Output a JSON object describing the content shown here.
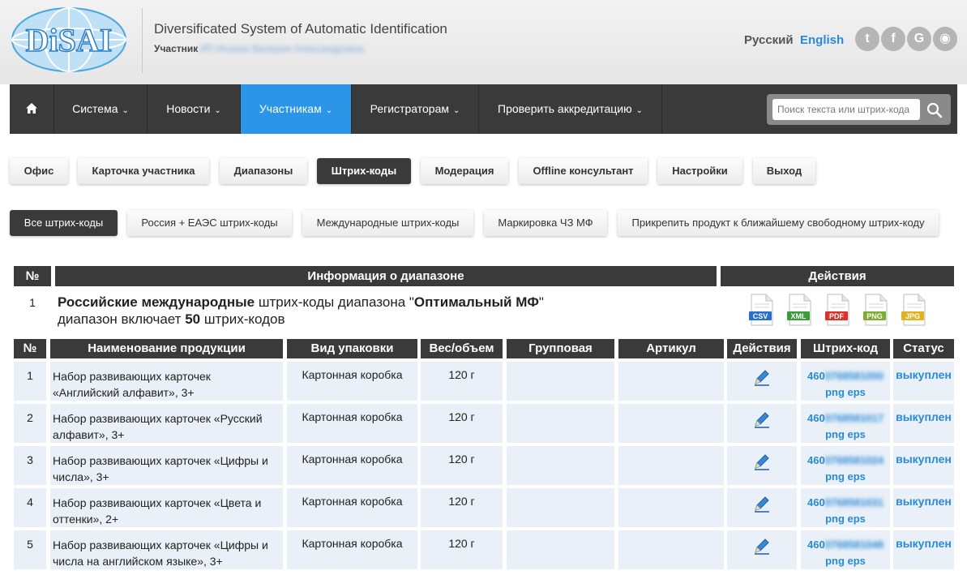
{
  "header": {
    "site_title": "Diversificated System of Automatic Identification",
    "participant_label": "Участник",
    "participant_name": "ИП Исаева Валерия Александровна",
    "lang_ru": "Русский",
    "lang_en": "English",
    "social": [
      {
        "icon": "twitter-icon",
        "glyph": "t"
      },
      {
        "icon": "facebook-icon",
        "glyph": "f"
      },
      {
        "icon": "google-icon",
        "glyph": "G"
      },
      {
        "icon": "rss-icon",
        "glyph": "◉"
      }
    ],
    "logo_text": "DiSAI"
  },
  "navbar": {
    "home_icon": "home-icon",
    "items": [
      {
        "label": "Система"
      },
      {
        "label": "Новости"
      },
      {
        "label": "Участникам"
      },
      {
        "label": "Регистраторам"
      },
      {
        "label": "Проверить аккредитацию"
      }
    ],
    "active_item": "Участникам",
    "search_placeholder": "Поиск текста или штрих-кода"
  },
  "tabs": [
    {
      "label": "Офис"
    },
    {
      "label": "Карточка участника"
    },
    {
      "label": "Диапазоны"
    },
    {
      "label": "Штрих-коды"
    },
    {
      "label": "Модерация"
    },
    {
      "label": "Offline консультант"
    },
    {
      "label": "Настройки"
    },
    {
      "label": "Выход"
    }
  ],
  "active_tab": "Штрих-коды",
  "subtabs": [
    {
      "label": "Все штрих-коды"
    },
    {
      "label": "Россия + ЕАЭС штрих-коды"
    },
    {
      "label": "Международные штрих-коды"
    },
    {
      "label": "Маркировка ЧЗ МФ"
    },
    {
      "label": "Прикрепить продукт к ближайшему свободному штрих-коду"
    }
  ],
  "active_subtab": "Все штрих-коды",
  "range_table": {
    "headers": {
      "num": "№",
      "info": "Информация о диапазоне",
      "actions": "Действия"
    },
    "row": {
      "num": "1",
      "line1_bold": "Российские международные",
      "line1_mid": " штрих-коды диапазона \"",
      "line1_name": "Оптимальный МФ",
      "line1_end": "\"",
      "line2_start": "диапазон включает ",
      "line2_count": "50",
      "line2_end": " штрих-кодов"
    },
    "exports": [
      {
        "label": "CSV",
        "color": "#2a6fc9"
      },
      {
        "label": "XML",
        "color": "#3b9a3b"
      },
      {
        "label": "PDF",
        "color": "#d9312b"
      },
      {
        "label": "PNG",
        "color": "#7fae2f"
      },
      {
        "label": "JPG",
        "color": "#e0b320"
      }
    ]
  },
  "product_table": {
    "headers": {
      "num": "№",
      "name": "Наименование продукции",
      "pack": "Вид упаковки",
      "weight": "Вес/объем",
      "group": "Групповая",
      "article": "Артикул",
      "actions": "Действия",
      "barcode": "Штрих-код",
      "status": "Статус"
    },
    "rows": [
      {
        "num": "1",
        "name": "Набор развивающих карточек «Английский алфавит», 3+",
        "pack": "Картонная коробка",
        "weight": "120 г",
        "group": "",
        "article": "",
        "barcode_prefix": "460",
        "barcode_rest": "0768581000",
        "barcode_links": "png eps",
        "status": "выкуплен"
      },
      {
        "num": "2",
        "name": "Набор развивающих карточек «Русский алфавит», 3+",
        "pack": "Картонная коробка",
        "weight": "120 г",
        "group": "",
        "article": "",
        "barcode_prefix": "460",
        "barcode_rest": "0768581017",
        "barcode_links": "png eps",
        "status": "выкуплен"
      },
      {
        "num": "3",
        "name": "Набор развивающих карточек «Цифры и числа», 3+",
        "pack": "Картонная коробка",
        "weight": "120 г",
        "group": "",
        "article": "",
        "barcode_prefix": "460",
        "barcode_rest": "0768581024",
        "barcode_links": "png eps",
        "status": "выкуплен"
      },
      {
        "num": "4",
        "name": "Набор развивающих карточек «Цвета и оттенки», 2+",
        "pack": "Картонная коробка",
        "weight": "120 г",
        "group": "",
        "article": "",
        "barcode_prefix": "460",
        "barcode_rest": "0768581031",
        "barcode_links": "png eps",
        "status": "выкуплен"
      },
      {
        "num": "5",
        "name": "Набор развивающих карточек «Цифры и числа на английском языке», 3+",
        "pack": "Картонная коробка",
        "weight": "120 г",
        "group": "",
        "article": "",
        "barcode_prefix": "460",
        "barcode_rest": "0768581048",
        "barcode_links": "png eps",
        "status": "выкуплен"
      }
    ]
  }
}
